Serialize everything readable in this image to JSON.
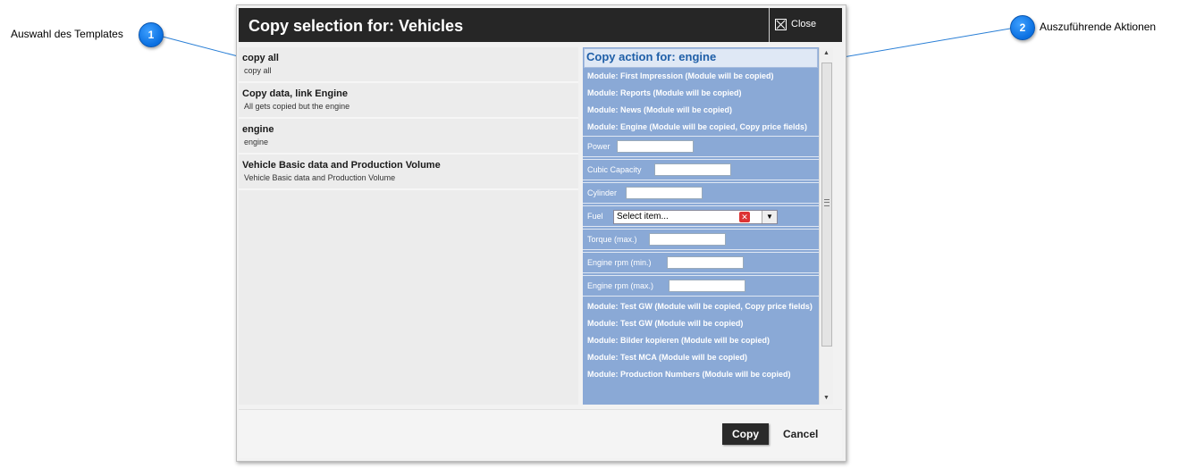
{
  "callouts": [
    {
      "number": "1",
      "label": "Auswahl des Templates"
    },
    {
      "number": "2",
      "label": "Auszuführende Aktionen"
    }
  ],
  "dialog": {
    "title": "Copy selection for: Vehicles",
    "close_label": "Close",
    "templates": [
      {
        "name": "copy all",
        "description": "copy all"
      },
      {
        "name": "Copy data, link Engine",
        "description": "All gets copied but the engine"
      },
      {
        "name": "engine",
        "description": "engine"
      },
      {
        "name": "Vehicle Basic data and Production Volume",
        "description": "Vehicle Basic data and Production Volume"
      }
    ],
    "actions": {
      "header": "Copy action for: engine",
      "modules_top": [
        "Module: First Impression (Module will be copied)",
        "Module: Reports (Module will be copied)",
        "Module: News (Module will be copied)",
        "Module: Engine (Module will be copied, Copy price fields)"
      ],
      "fields": {
        "power": "Power",
        "cubic_capacity": "Cubic Capacity",
        "cylinder": "Cylinder",
        "fuel": "Fuel",
        "fuel_placeholder": "Select item...",
        "torque": "Torque (max.)",
        "rpm_min": "Engine rpm (min.)",
        "rpm_max": "Engine rpm (max.)"
      },
      "modules_bottom": [
        "Module: Test GW (Module will be copied, Copy price fields)",
        "Module: Test GW (Module will be copied)",
        "Module: Bilder kopieren (Module will be copied)",
        "Module: Test MCA (Module will be copied)",
        "Module: Production Numbers (Module will be copied)"
      ]
    },
    "buttons": {
      "copy": "Copy",
      "cancel": "Cancel"
    }
  }
}
